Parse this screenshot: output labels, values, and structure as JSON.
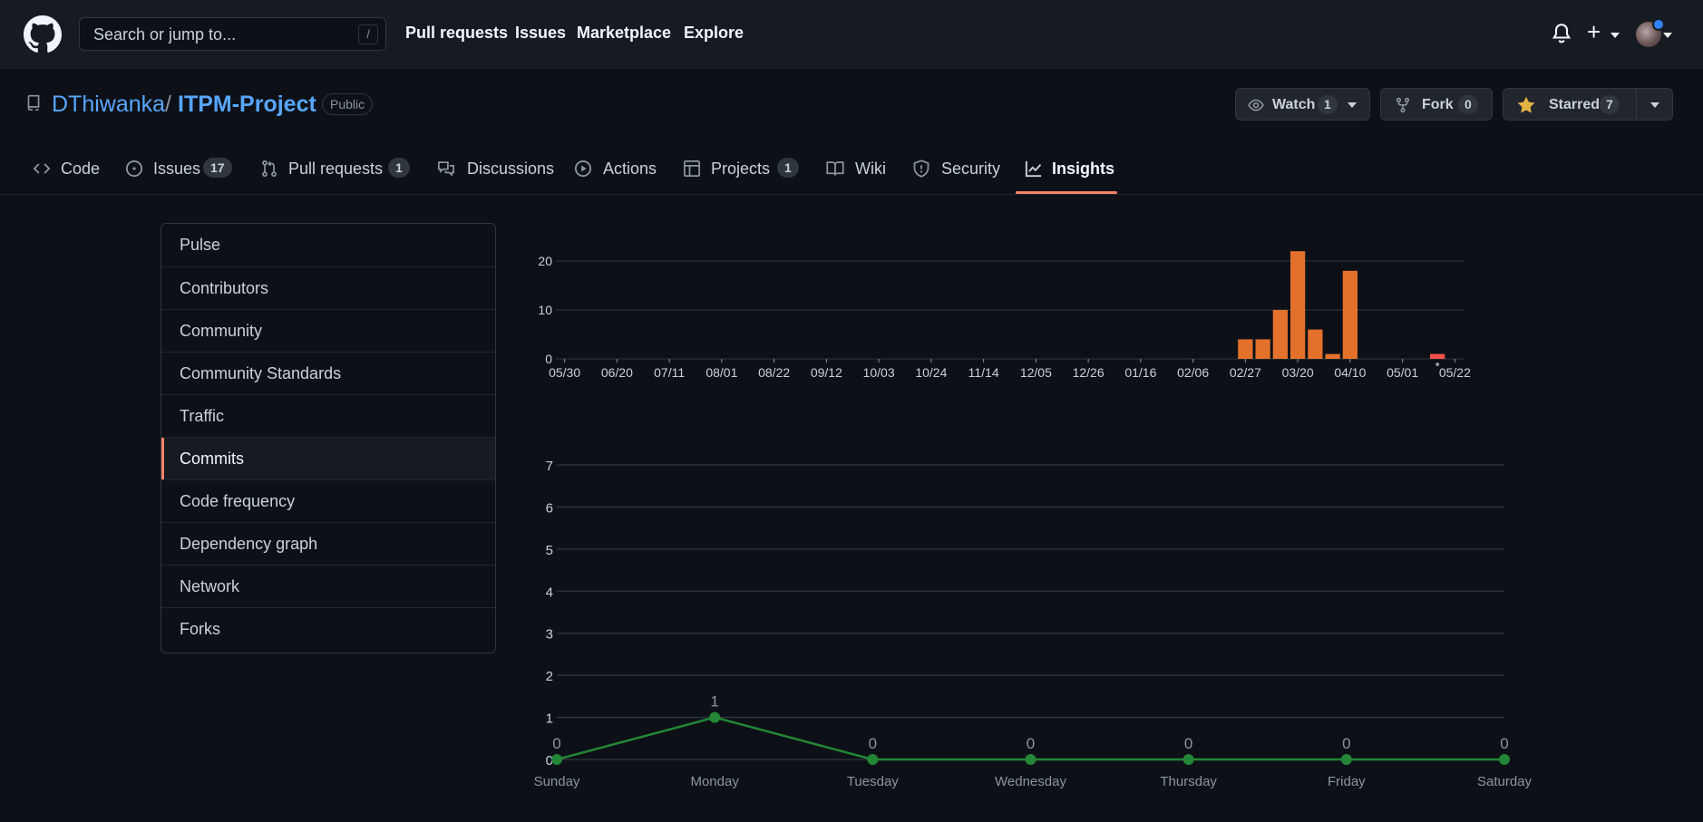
{
  "header": {
    "search_placeholder": "Search or jump to...",
    "search_key": "/",
    "nav": [
      "Pull requests",
      "Issues",
      "Marketplace",
      "Explore"
    ]
  },
  "repo": {
    "owner": "DThiwanka",
    "separator": "/",
    "name": "ITPM-Project",
    "visibility": "Public"
  },
  "actions": {
    "watch": {
      "label": "Watch",
      "count": "1"
    },
    "fork": {
      "label": "Fork",
      "count": "0"
    },
    "star": {
      "label": "Starred",
      "count": "7"
    }
  },
  "tabs": [
    {
      "label": "Code",
      "icon": "code-icon"
    },
    {
      "label": "Issues",
      "icon": "issue-icon",
      "count": "17"
    },
    {
      "label": "Pull requests",
      "icon": "pull-request-icon",
      "count": "1"
    },
    {
      "label": "Discussions",
      "icon": "discussion-icon"
    },
    {
      "label": "Actions",
      "icon": "play-icon"
    },
    {
      "label": "Projects",
      "icon": "table-icon",
      "count": "1"
    },
    {
      "label": "Wiki",
      "icon": "book-icon"
    },
    {
      "label": "Security",
      "icon": "shield-icon"
    },
    {
      "label": "Insights",
      "icon": "graph-icon",
      "active": true
    }
  ],
  "sidebar": {
    "items": [
      "Pulse",
      "Contributors",
      "Community",
      "Community Standards",
      "Traffic",
      "Commits",
      "Code frequency",
      "Dependency graph",
      "Network",
      "Forks"
    ],
    "selected": "Commits"
  },
  "colors": {
    "background": "#0d1117",
    "header": "#161b22",
    "link": "#58a6ff",
    "bar": "#e3712b",
    "bar_selected": "#f85149",
    "line": "#238636",
    "tab_underline": "#f78166"
  },
  "chart_data": [
    {
      "type": "bar",
      "ylim": [
        0,
        20
      ],
      "yticks": [
        "0",
        "10",
        "20"
      ],
      "xticks": [
        "05/30",
        "06/20",
        "07/11",
        "08/01",
        "08/22",
        "09/12",
        "10/03",
        "10/24",
        "11/14",
        "12/05",
        "12/26",
        "01/16",
        "02/06",
        "02/27",
        "03/20",
        "04/10",
        "05/01",
        "05/22"
      ],
      "weeks": 52,
      "values": [
        0,
        0,
        0,
        0,
        0,
        0,
        0,
        0,
        0,
        0,
        0,
        0,
        0,
        0,
        0,
        0,
        0,
        0,
        0,
        0,
        0,
        0,
        0,
        0,
        0,
        0,
        0,
        0,
        0,
        0,
        0,
        0,
        0,
        0,
        0,
        0,
        0,
        0,
        0,
        4,
        4,
        10,
        22,
        6,
        1,
        18,
        0,
        0,
        0,
        0,
        1,
        0
      ],
      "selected_index": 50,
      "grid": true
    },
    {
      "type": "line",
      "categories": [
        "Sunday",
        "Monday",
        "Tuesday",
        "Wednesday",
        "Thursday",
        "Friday",
        "Saturday"
      ],
      "values": [
        0,
        1,
        0,
        0,
        0,
        0,
        0
      ],
      "data_labels": [
        "0",
        "1",
        "0",
        "0",
        "0",
        "0",
        "0"
      ],
      "ylim": [
        0,
        7
      ],
      "yticks": [
        "0",
        "1",
        "2",
        "3",
        "4",
        "5",
        "6",
        "7"
      ],
      "grid": true
    }
  ]
}
